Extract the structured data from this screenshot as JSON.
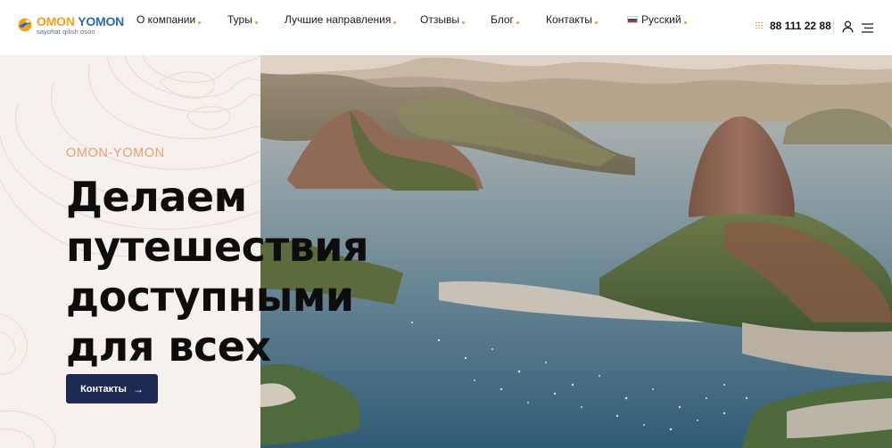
{
  "brand": {
    "name_part1": "OMON",
    "name_part2": "YOMON",
    "tagline": "sayohat qilish oson"
  },
  "nav": {
    "items": [
      {
        "label": "О компании"
      },
      {
        "label": "Туры"
      },
      {
        "label": "Лучшие направления"
      },
      {
        "label": "Отзывы"
      },
      {
        "label": "Блог"
      },
      {
        "label": "Контакты"
      },
      {
        "label": "Русский"
      }
    ]
  },
  "header": {
    "phone": "88 111 22 88"
  },
  "hero": {
    "kicker": "OMON-YOMON",
    "headline": [
      "Делаем",
      "путешествия",
      "доступными",
      "для всех"
    ],
    "cta_label": "Контакты"
  },
  "colors": {
    "accent_orange": "#f0a01c",
    "brand_blue": "#2a6ab4",
    "cta_navy": "#1e2a52",
    "kicker": "#e2a075",
    "hero_left_bg": "#f7f1ee"
  },
  "icons": [
    "logo-icon",
    "flag-ru-icon",
    "dial-grid-icon",
    "user-icon",
    "hamburger-menu-icon",
    "arrow-right-icon"
  ]
}
